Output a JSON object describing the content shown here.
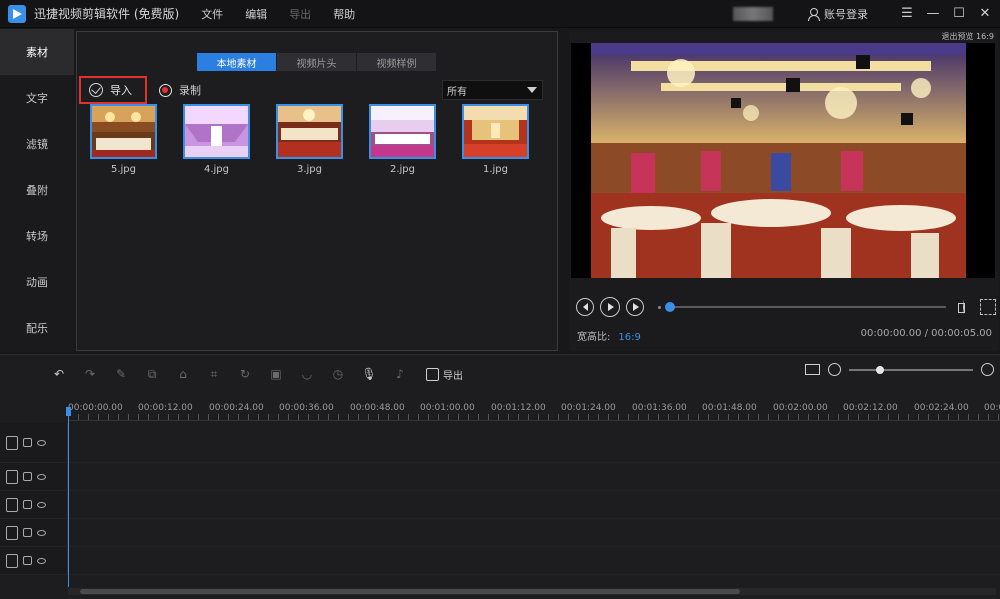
{
  "titlebar": {
    "app_title": "迅捷视频剪辑软件 (免费版)",
    "menu": [
      {
        "label": "文件",
        "enabled": true
      },
      {
        "label": "编辑",
        "enabled": true
      },
      {
        "label": "导出",
        "enabled": false
      },
      {
        "label": "帮助",
        "enabled": true
      }
    ],
    "login_label": "账号登录",
    "window_buttons": [
      "menu-icon",
      "minimize-icon",
      "maximize-icon",
      "close-icon"
    ]
  },
  "leftnav": {
    "items": [
      {
        "label": "素材",
        "active": true
      },
      {
        "label": "文字",
        "active": false
      },
      {
        "label": "滤镜",
        "active": false
      },
      {
        "label": "叠附",
        "active": false
      },
      {
        "label": "转场",
        "active": false
      },
      {
        "label": "动画",
        "active": false
      },
      {
        "label": "配乐",
        "active": false
      }
    ]
  },
  "media": {
    "tabs": [
      {
        "label": "本地素材",
        "active": true
      },
      {
        "label": "视频片头",
        "active": false
      },
      {
        "label": "视频样例",
        "active": false
      }
    ],
    "import_label": "导入",
    "record_label": "录制",
    "filter_value": "所有",
    "files": [
      {
        "name": "5.jpg"
      },
      {
        "name": "4.jpg"
      },
      {
        "name": "3.jpg"
      },
      {
        "name": "2.jpg"
      },
      {
        "name": "1.jpg"
      }
    ]
  },
  "preview": {
    "tag": "退出预览 16:9",
    "ratio_label": "宽高比:",
    "ratio_value": "16:9",
    "timecode": "00:00:00.00 / 00:00:05.00",
    "progress": 0.0
  },
  "timeline": {
    "export_label": "导出",
    "zoom_level": 0.25,
    "ruler": [
      "00:00:00.00",
      "00:00:12.00",
      "00:00:24.00",
      "00:00:36.00",
      "00:00:48.00",
      "00:01:00.00",
      "00:01:12.00",
      "00:01:24.00",
      "00:01:36.00",
      "00:01:48.00",
      "00:02:00.00",
      "00:02:12.00",
      "00:02:24.00",
      "00:0"
    ],
    "tracks": [
      "video-track-icon",
      "video-track-2-icon",
      "text-track-icon",
      "music-track-icon",
      "mic-track-icon"
    ]
  },
  "colors": {
    "accent": "#2b7fe0",
    "highlight_border": "#e23131",
    "background": "#18181a"
  }
}
